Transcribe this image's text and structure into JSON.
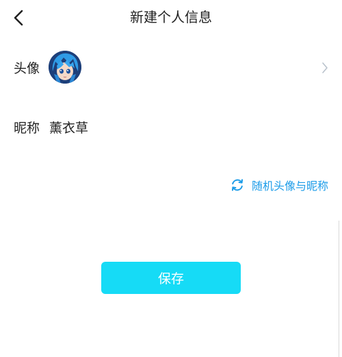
{
  "header": {
    "title": "新建个人信息",
    "back_icon": "chevron-left-icon"
  },
  "avatar_row": {
    "label": "头像",
    "avatar_icon": "anime-avatar",
    "chevron_icon": "chevron-right-icon"
  },
  "nickname_row": {
    "label": "昵称",
    "value": "薰衣草"
  },
  "random_action": {
    "label": "随机头像与昵称",
    "icon": "refresh-icon",
    "color": "#1a9be8"
  },
  "save_button": {
    "label": "保存",
    "color": "#16dbf6"
  }
}
